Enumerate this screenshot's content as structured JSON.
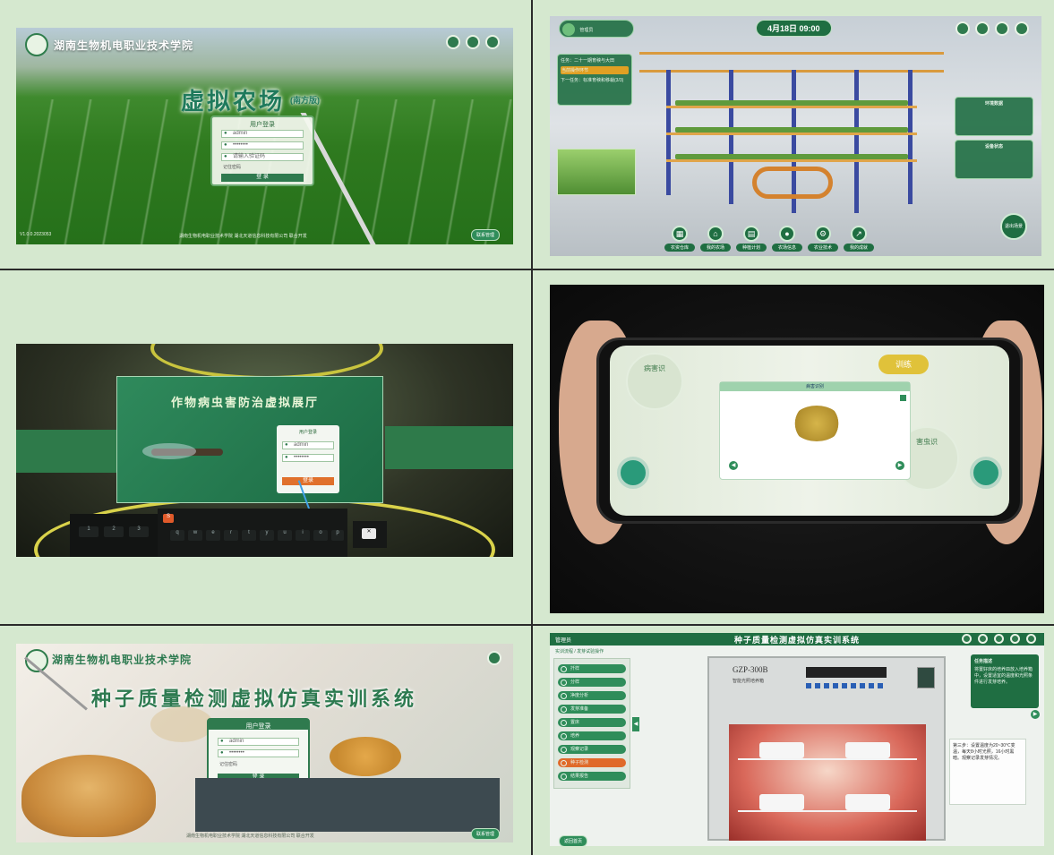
{
  "panel1": {
    "college_name": "湖南生物机电职业技术学院",
    "title": "虚拟农场",
    "subtitle": "(南方版)",
    "login": {
      "title": "用户登录",
      "username": "admin",
      "password": "••••••••",
      "captcha": "请输入验证码",
      "remember": "记住密码",
      "submit": "登 录"
    },
    "version": "V1.0.0.2023053",
    "footer_text": "湖南生物机电职业技术学院    湖北天道信息科技有限公司    联合开发",
    "corner_button": "联系管理"
  },
  "panel2": {
    "time": "4月18日 09:00",
    "user_label": "管理员",
    "tasks": {
      "line1": "任务：二十一期育秧与大田",
      "highlight": "当前操作环节",
      "line2": "下一任务：标准育秧和移栽(3/3)"
    },
    "right_card_title": "环境数据",
    "right_card2_title": "设备状态",
    "toolbar": [
      "农资仓库",
      "我的农场",
      "种植计划",
      "农场信息",
      "农业技术",
      "我的成就"
    ],
    "corner_label": "退出场景"
  },
  "panel3": {
    "title": "作物病虫害防治虚拟展厅",
    "login": {
      "title": "用户登录",
      "username": "admin",
      "password": "••••••••",
      "submit": "登录"
    },
    "keys": [
      "1",
      "2",
      "3",
      "q",
      "w",
      "e",
      "r",
      "t",
      "y",
      "u",
      "i",
      "o",
      "p"
    ]
  },
  "panel4": {
    "left_badge": "病害识",
    "right_badge": "训练",
    "right_bottom_badge": "害虫识",
    "modal_title": "病害识别"
  },
  "panel5": {
    "college_name": "湖南生物机电职业技术学院",
    "title": "种子质量检测虚拟仿真实训系统",
    "login": {
      "title": "用户登录",
      "username": "admin",
      "password": "••••••••",
      "remember": "记住密码",
      "submit": "登 录"
    },
    "footer_text": "湖南生物机电职业技术学院    湖北天道信息科技有限公司    联合开发",
    "corner_button": "联系管理"
  },
  "panel6": {
    "title": "种子质量检测虚拟仿真实训系统",
    "user_label": "管理员",
    "breadcrumb": "实训流程  / 发芽试验操作",
    "steps": [
      "扦样",
      "分样",
      "净度分析",
      "发芽准备",
      "置床",
      "培养",
      "观察记录",
      "种子检测",
      "结果报告"
    ],
    "device_model": "GZP-300B",
    "device_name": "智能光照培养箱",
    "info_title": "任务描述",
    "info_text": "将置好床的培养皿放入培养箱中，设置适宜的温度和光照条件进行发芽培养。",
    "side_text": "第三步：设置温度为20~30℃变温，每天8小时光照，16小时黑暗。观察记录发芽情况。",
    "bottom_button": "返回首页"
  }
}
